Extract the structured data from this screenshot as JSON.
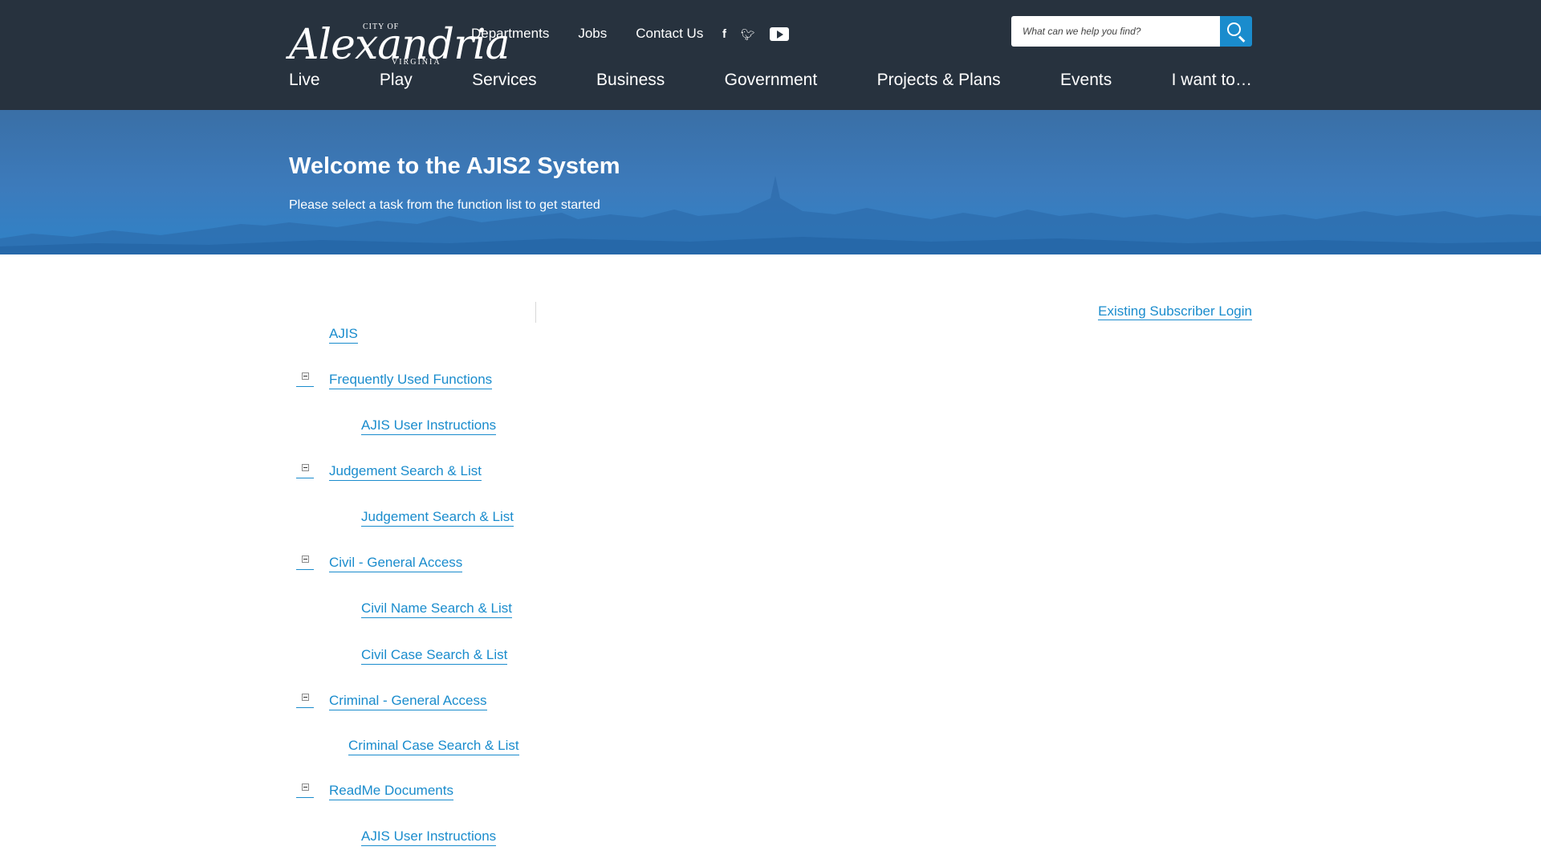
{
  "header": {
    "logo": {
      "city": "CITY OF",
      "name": "Alexandria",
      "state": "VIRGINIA"
    },
    "utility_nav": [
      "Departments",
      "Jobs",
      "Contact Us"
    ],
    "social_icons": [
      "facebook-icon",
      "twitter-icon",
      "youtube-icon"
    ],
    "search": {
      "placeholder": "What can we help you find?"
    },
    "main_nav": [
      "Live",
      "Play",
      "Services",
      "Business",
      "Government",
      "Projects & Plans",
      "Events",
      "I want to…"
    ]
  },
  "banner": {
    "title": "Welcome to the AJIS2 System",
    "subtitle": "Please select a task from the function list to get started"
  },
  "login_link": "Existing Subscriber Login",
  "tree": {
    "root": "AJIS",
    "groups": [
      {
        "label": "Frequently Used Functions",
        "items": [
          "AJIS User Instructions"
        ]
      },
      {
        "label": "Judgement Search & List",
        "items": [
          "Judgement Search & List"
        ]
      },
      {
        "label": "Civil - General Access",
        "items": [
          "Civil Name Search & List",
          "Civil Case Search & List"
        ]
      },
      {
        "label": "Criminal - General Access",
        "items": [
          "Criminal Case Search & List"
        ]
      },
      {
        "label": "ReadMe Documents",
        "items": [
          "AJIS User Instructions"
        ]
      }
    ]
  },
  "colors": {
    "header_bg": "#27323e",
    "accent": "#1a8ccd",
    "banner": "#3c7bbc"
  }
}
